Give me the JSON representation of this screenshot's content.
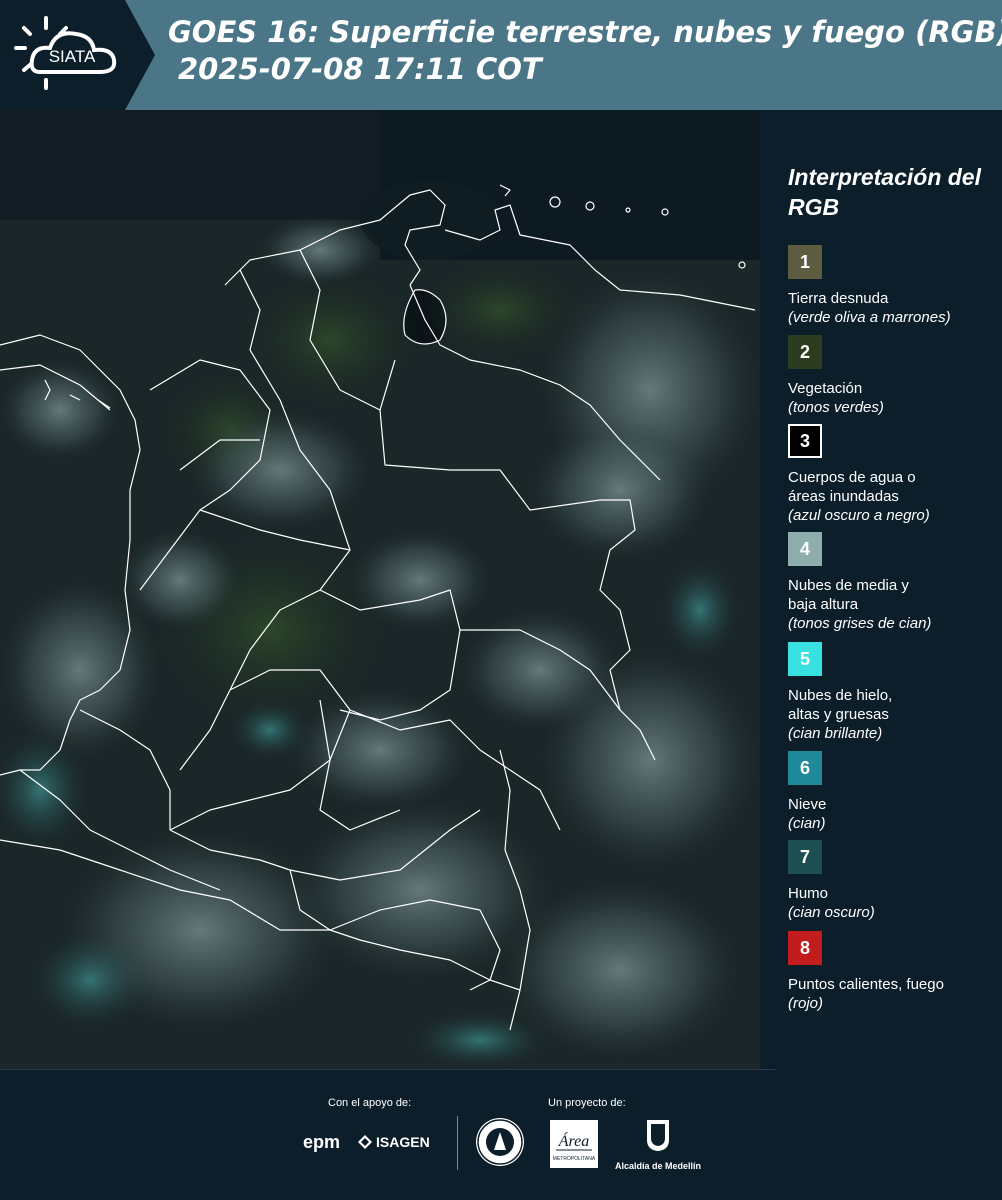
{
  "header": {
    "logo_text": "SIATA",
    "title_line1": "GOES 16: Superficie terrestre, nubes y fuego (RGB)",
    "title_line2": "2025-07-08 17:11 COT",
    "background_color": "#4a7687"
  },
  "map": {
    "description_icon": "satellite-map-colombia",
    "base_color": "#1a2a2e",
    "boundary_color": "#ffffff"
  },
  "legend": {
    "title": "Interpretación del RGB",
    "items": [
      {
        "number": "1",
        "color": "#5d5b40",
        "label": "Tierra desnuda",
        "sub": "(verde oliva a marrones)"
      },
      {
        "number": "2",
        "color": "#2b3d1e",
        "label": "Vegetación",
        "sub": "(tonos verdes)"
      },
      {
        "number": "3",
        "color": "#000000",
        "label": "Cuerpos de agua o\náreas inundadas",
        "sub": "(azul oscuro a negro)"
      },
      {
        "number": "4",
        "color": "#8eaeae",
        "label": "Nubes de media y\nbaja altura",
        "sub": "(tonos grises de cian)"
      },
      {
        "number": "5",
        "color": "#39e0e0",
        "label": "Nubes de hielo,\naltas y gruesas",
        "sub": "(cian brillante)"
      },
      {
        "number": "6",
        "color": "#208a9a",
        "label": "Nieve",
        "sub": "(cian)"
      },
      {
        "number": "7",
        "color": "#1e4f52",
        "label": "Humo",
        "sub": "(cian oscuro)"
      },
      {
        "number": "8",
        "color": "#c21c1c",
        "label": "Puntos calientes, fuego",
        "sub": "(rojo)"
      }
    ]
  },
  "footer": {
    "support_label": "Con el apoyo de:",
    "project_label": "Un proyecto de:",
    "sponsors": [
      "epm",
      "ISAGEN"
    ],
    "partners": [
      "Área Metropolitana",
      "Alcaldía de Medellín"
    ],
    "area_subtext": "METROPOLITANA",
    "alcaldia_label": "Alcaldía de Medellín"
  }
}
